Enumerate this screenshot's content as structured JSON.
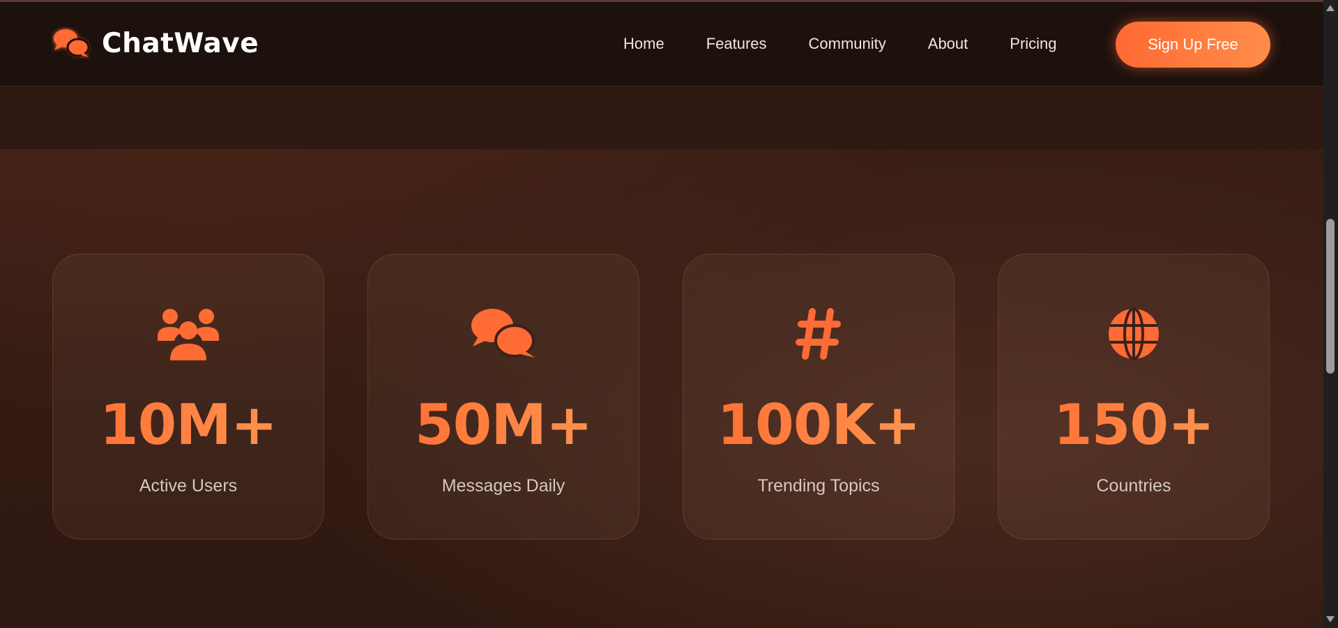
{
  "brand": {
    "name": "ChatWave",
    "icon": "chat-bubbles-icon",
    "accent_color": "#ff6b35"
  },
  "nav": {
    "links": [
      {
        "label": "Home"
      },
      {
        "label": "Features"
      },
      {
        "label": "Community"
      },
      {
        "label": "About"
      },
      {
        "label": "Pricing"
      }
    ],
    "cta_label": "Sign Up Free"
  },
  "stats": [
    {
      "icon": "users-icon",
      "value": "10M+",
      "label": "Active Users"
    },
    {
      "icon": "chat-bubbles-icon",
      "value": "50M+",
      "label": "Messages Daily"
    },
    {
      "icon": "hashtag-icon",
      "value": "100K+",
      "label": "Trending Topics"
    },
    {
      "icon": "globe-icon",
      "value": "150+",
      "label": "Countries"
    }
  ]
}
